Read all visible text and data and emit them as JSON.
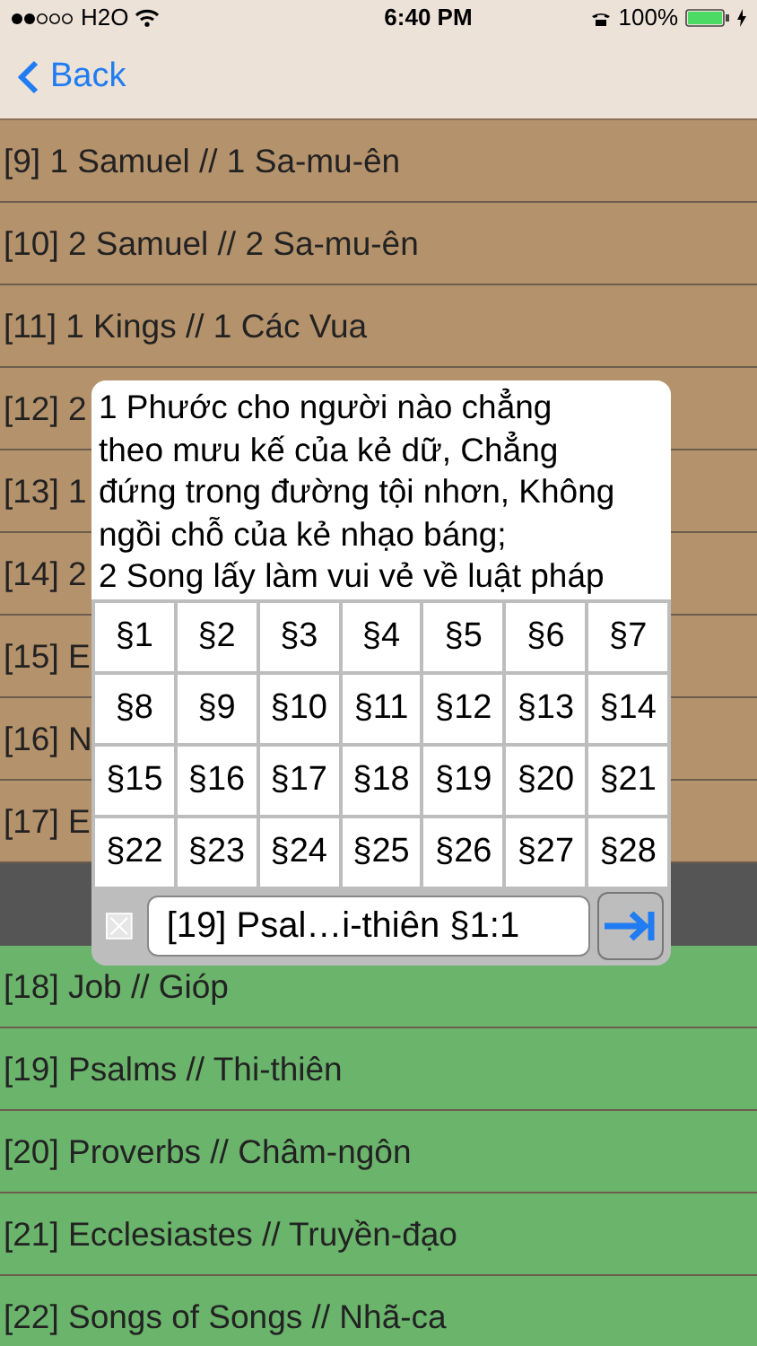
{
  "status_bar": {
    "carrier": "H2O",
    "time": "6:40 PM",
    "battery": "100%"
  },
  "nav": {
    "back": "Back"
  },
  "groups": [
    {
      "color": "#b4926c",
      "rows": [
        "[9] 1 Samuel // 1 Sa-mu-ên",
        "[10] 2 Samuel // 2 Sa-mu-ên",
        "[11] 1 Kings // 1 Các Vua",
        "[12] 2",
        "[13] 1",
        "[14] 2",
        "[15] E",
        "[16] N",
        "[17] E"
      ]
    },
    {
      "color": "#6bb46c",
      "rows": [
        "[18] Job // Gióp",
        "[19] Psalms // Thi-thiên",
        "[20] Proverbs // Châm-ngôn",
        "[21] Ecclesiastes // Truyền-đạo",
        "[22] Songs of Songs // Nhã-ca"
      ]
    }
  ],
  "popup": {
    "verses": [
      "1 Phước cho người nào chẳng theo mưu kế của kẻ dữ, Chẳng đứng trong đường tội nhơn, Không ngồi chỗ của kẻ nhạo báng;",
      "2 Song lấy làm vui vẻ về luật pháp"
    ],
    "sections": [
      "§1",
      "§2",
      "§3",
      "§4",
      "§5",
      "§6",
      "§7",
      "§8",
      "§9",
      "§10",
      "§11",
      "§12",
      "§13",
      "§14",
      "§15",
      "§16",
      "§17",
      "§18",
      "§19",
      "§20",
      "§21",
      "§22",
      "§23",
      "§24",
      "§25",
      "§26",
      "§27",
      "§28"
    ],
    "reference": "[19] Psal…i-thiên §1:1"
  }
}
